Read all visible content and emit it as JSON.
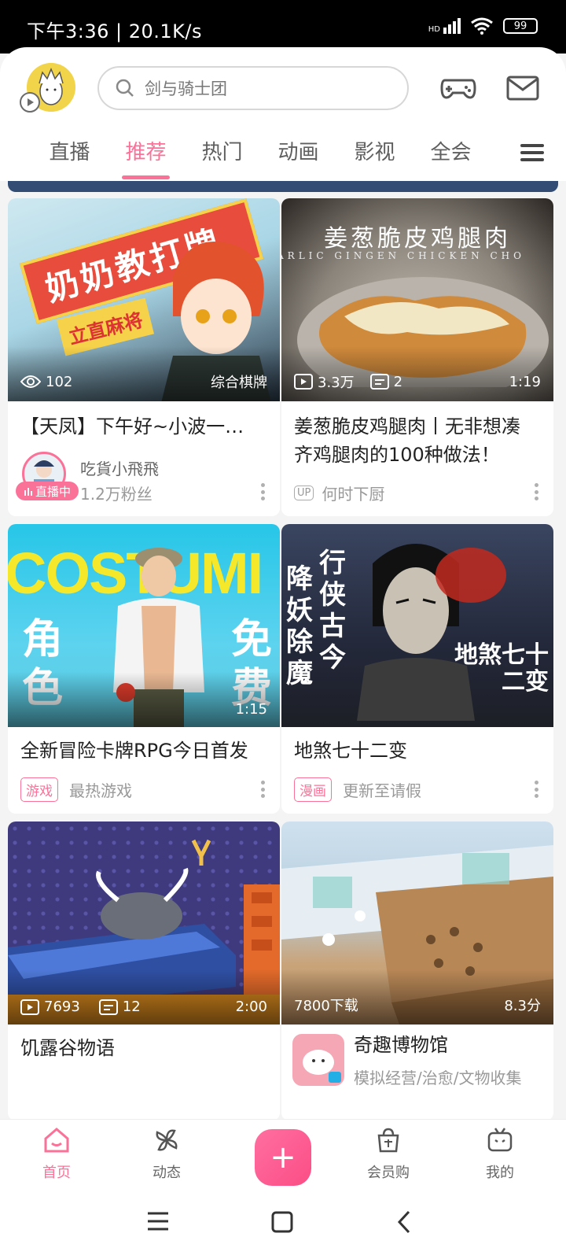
{
  "status_bar": {
    "time_speed": "下午3:36 | 20.1K/s",
    "battery": "99",
    "network_label": "HD"
  },
  "header": {
    "search_placeholder": "剑与骑士团"
  },
  "tabs": [
    {
      "label": "直播"
    },
    {
      "label": "推荐"
    },
    {
      "label": "热门"
    },
    {
      "label": "动画"
    },
    {
      "label": "影视"
    },
    {
      "label": "全会"
    }
  ],
  "active_tab": "推荐",
  "cards": [
    {
      "thumb_title": "奶奶教打牌",
      "thumb_sub": "立直麻将",
      "views": "102",
      "category": "综合棋牌",
      "title": "【天凤】下午好~小波一…",
      "author": "吃貨小飛飛",
      "fans": "1.2万粉丝",
      "live_badge": "直播中"
    },
    {
      "thumb_title": "姜葱脆皮鸡腿肉",
      "thumb_sub": "ARLIC GINGEN CHICKEN CHO",
      "views": "3.3万",
      "comments": "2",
      "duration": "1:19",
      "title": "姜葱脆皮鸡腿肉丨无非想凑齐鸡腿肉的100种做法！",
      "up_label": "UP",
      "author": "何时下厨"
    },
    {
      "thumb_title": "COSTUMI",
      "thumb_left": "角色",
      "thumb_right": "免费",
      "duration": "1:15",
      "title": "全新冒险卡牌RPG今日首发",
      "tag": "游戏",
      "meta": "最热游戏"
    },
    {
      "thumb_left": "降妖除魔",
      "thumb_right": "行侠古今",
      "thumb_corner": "地煞七十二变",
      "title": "地煞七十二变",
      "tag": "漫画",
      "meta": "更新至请假"
    },
    {
      "views": "7693",
      "comments": "12",
      "duration": "2:00",
      "title": "饥露谷物语"
    },
    {
      "downloads": "7800下载",
      "score": "8.3分",
      "title": "奇趣博物馆",
      "meta": "模拟经营/治愈/文物收集"
    }
  ],
  "bottom_nav": [
    {
      "label": "首页"
    },
    {
      "label": "动态"
    },
    {
      "label": "会员购"
    },
    {
      "label": "我的"
    }
  ],
  "fab_label": "+"
}
